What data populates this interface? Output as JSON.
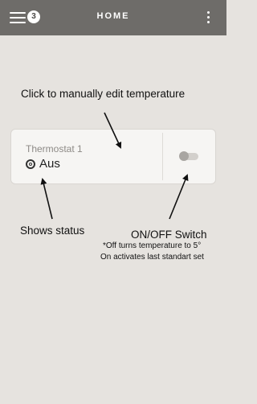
{
  "header": {
    "title": "HOME",
    "notification_count": "3",
    "menu_icon": "hamburger-menu-icon",
    "more_icon": "vertical-dots-icon"
  },
  "device": {
    "name": "Thermostat 1",
    "status": "Aus",
    "status_icon": "off-status-icon",
    "switch_state": "off"
  },
  "annotations": {
    "edit_temperature": "Click to manually edit temperature",
    "shows_status": "Shows status",
    "switch_label": "ON/OFF Switch",
    "switch_note_1": "*Off turns temperature to 5°",
    "switch_note_2": "On activates last standart set"
  },
  "colors": {
    "topbar": "#6e6c69",
    "background": "#e6e3df",
    "card": "#f6f5f3"
  }
}
